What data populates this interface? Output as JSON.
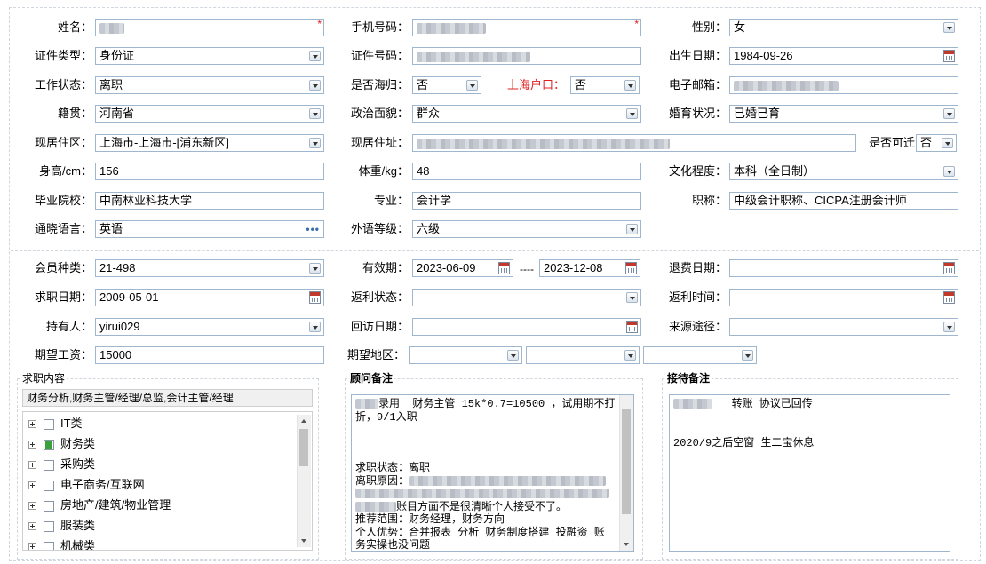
{
  "form": {
    "name_label": "姓名：",
    "required_mark": "*",
    "phone_label": "手机号码：",
    "gender_label": "性别：",
    "gender_value": "女",
    "idtype_label": "证件类型：",
    "idtype_value": "身份证",
    "idno_label": "证件号码：",
    "birth_label": "出生日期：",
    "birth_value": "1984-09-26",
    "workstatus_label": "工作状态：",
    "workstatus_value": "离职",
    "returnee_label": "是否海归：",
    "returnee_value": "否",
    "shhukou_label": "上海户口：",
    "shhukou_value": "否",
    "email_label": "电子邮箱：",
    "native_label": "籍贯：",
    "native_value": "河南省",
    "political_label": "政治面貌：",
    "political_value": "群众",
    "marital_label": "婚育状况：",
    "marital_value": "已婚已育",
    "district_label": "现居住区：",
    "district_value": "上海市-上海市-[浦东新区]",
    "address_label": "现居住址：",
    "relocate_label": "是否可迁",
    "relocate_value": "否",
    "height_label": "身高/cm：",
    "height_value": "156",
    "weight_label": "体重/kg：",
    "weight_value": "48",
    "education_label": "文化程度：",
    "education_value": "本科（全日制）",
    "school_label": "毕业院校：",
    "school_value": "中南林业科技大学",
    "major_label": "专业：",
    "major_value": "会计学",
    "title_label": "职称：",
    "title_value": "中级会计职称、CICPA注册会计师",
    "language_label": "通晓语言：",
    "language_value": "英语",
    "foreignlevel_label": "外语等级：",
    "foreignlevel_value": "六级",
    "membertype_label": "会员种类：",
    "membertype_value": "21-498",
    "validity_label": "有效期：",
    "validity_from": "2023-06-09",
    "validity_sep": "----",
    "validity_to": "2023-12-08",
    "refunddate_label": "退费日期：",
    "jobdate_label": "求职日期：",
    "jobdate_value": "2009-05-01",
    "rebatestatus_label": "返利状态：",
    "rebatetime_label": "返利时间：",
    "holder_label": "持有人：",
    "holder_value": "yirui029",
    "revisit_label": "回访日期：",
    "source_label": "来源途径：",
    "salary_label": "期望工资：",
    "salary_value": "15000",
    "region_label": "期望地区："
  },
  "job": {
    "section_title": "求职内容",
    "selected": "财务分析,财务主管/经理/总监,会计主管/经理",
    "categories": [
      {
        "label": "IT类",
        "checked": false
      },
      {
        "label": "财务类",
        "checked": true
      },
      {
        "label": "采购类",
        "checked": false
      },
      {
        "label": "电子商务/互联网",
        "checked": false
      },
      {
        "label": "房地产/建筑/物业管理",
        "checked": false
      },
      {
        "label": "服装类",
        "checked": false
      },
      {
        "label": "机械类",
        "checked": false
      }
    ]
  },
  "consultant": {
    "section_title": "顾问备注",
    "line1_tail": "录用  财务主管 15k*0.7=10500 ，试用期不打折，9/1入职",
    "status": "求职状态：离职",
    "reason_label": "离职原因：",
    "reason_tail": "账目方面不是很清晰个人接受不了。",
    "scope": "推荐范围：财务经理，财务方向",
    "strength": "个人优势：合并报表 分析 财务制度搭建 投融资 账",
    "strength_cont": "务实操也没问题"
  },
  "reception": {
    "section_title": "接待备注",
    "line1_tail": "转账 协议已回传",
    "line2": "2020/9之后空窗 生二宝休息"
  }
}
